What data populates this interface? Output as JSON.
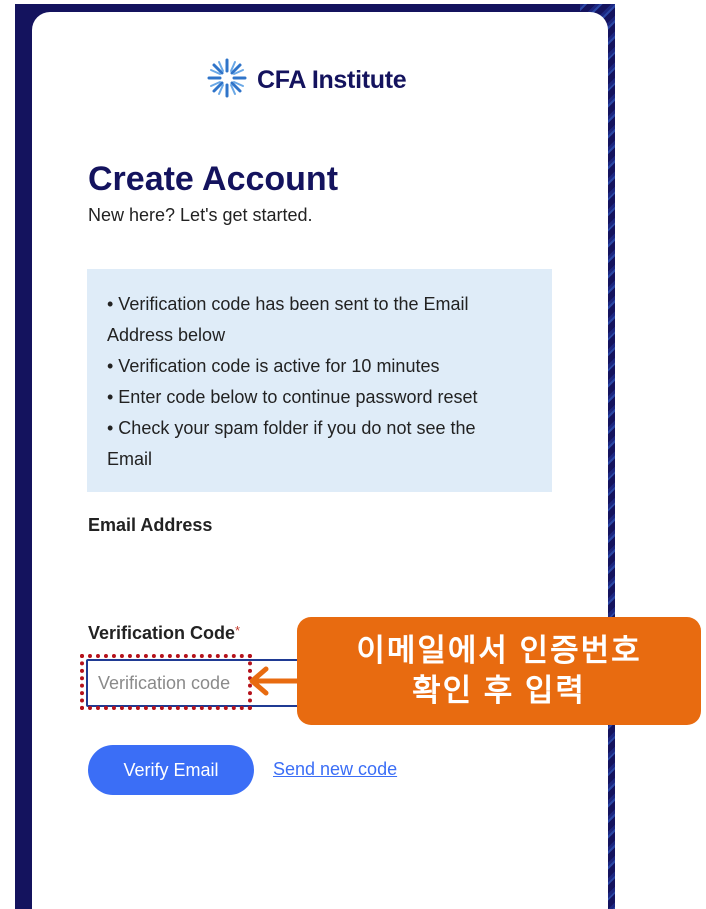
{
  "logo": {
    "text": "CFA Institute",
    "icon": "cfa-starburst-icon"
  },
  "header": {
    "title": "Create Account",
    "subtitle": "New here? Let's get started."
  },
  "info": {
    "lines": [
      "• Verification code has been sent to the Email",
      "Address below",
      "• Verification code is active for 10 minutes",
      "• Enter code below to continue password reset",
      "• Check your spam folder if you do not see the",
      "Email"
    ]
  },
  "form": {
    "email_label": "Email Address",
    "code_label": "Verification Code",
    "required_mark": "*",
    "code_placeholder": "Verification code",
    "code_value": ""
  },
  "actions": {
    "verify_label": "Verify Email",
    "send_new_code_label": "Send new code"
  },
  "callout": {
    "line1": "이메일에서 인증번호",
    "line2": "확인 후 입력"
  },
  "colors": {
    "brand_navy": "#14135e",
    "button_blue": "#3b6ef6",
    "info_bg": "#dfecf8",
    "callout_orange": "#e86b10",
    "highlight_red": "#b5121b"
  }
}
